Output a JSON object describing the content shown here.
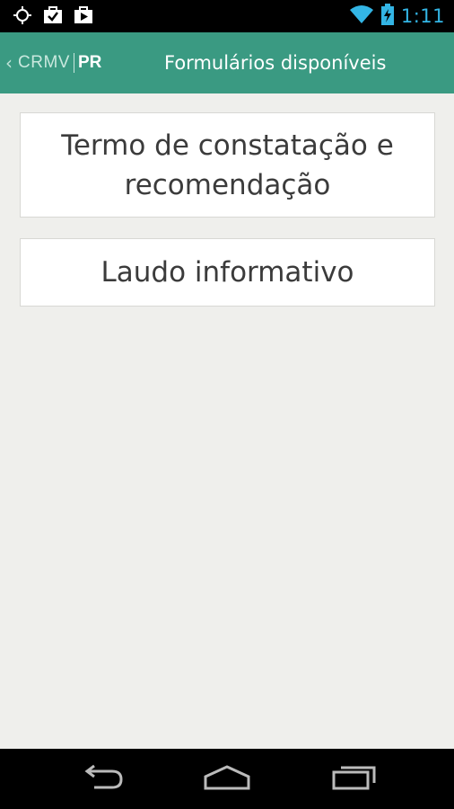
{
  "status_bar": {
    "time": "1:11",
    "icons": [
      "gps-icon",
      "briefcase-check-icon",
      "play-store-icon",
      "wifi-icon",
      "battery-charging-icon"
    ],
    "clock_color": "#33b5e5"
  },
  "action_bar": {
    "background": "#3a9a82",
    "back_chevron": "‹",
    "logo_left": "CRMV",
    "logo_right": "PR",
    "title": "Formulários disponíveis"
  },
  "forms": [
    {
      "label": "Termo de constatação e recomendação"
    },
    {
      "label": "Laudo informativo"
    }
  ],
  "nav_bar": {
    "icons": [
      "back-icon",
      "home-icon",
      "recent-apps-icon"
    ]
  }
}
